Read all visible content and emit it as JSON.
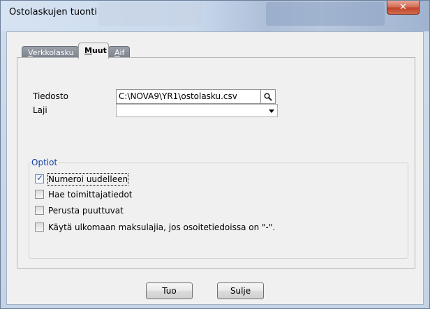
{
  "window": {
    "title": "Ostolaskujen tuonti",
    "close_glyph": "✕"
  },
  "tabs": [
    {
      "key": "V",
      "rest": "erkkolasku",
      "active": false
    },
    {
      "key": "M",
      "rest": "uut",
      "active": true
    },
    {
      "key": "A",
      "rest": "if",
      "active": false
    }
  ],
  "form": {
    "file_label": "Tiedosto",
    "file_value": "C:\\NOVA9\\YR1\\ostolasku.csv",
    "browse_icon": "search-icon",
    "type_label": "Laji",
    "type_value": ""
  },
  "options": {
    "group_label": "Optiot",
    "items": [
      {
        "label": "Numeroi uudelleen",
        "checked": true
      },
      {
        "label": "Hae toimittajatiedot",
        "checked": false
      },
      {
        "label": "Perusta puuttuvat",
        "checked": false
      },
      {
        "label": "Käytä ulkomaan maksulajia, jos osoitetiedoissa on \"-\".",
        "checked": false
      }
    ]
  },
  "buttons": {
    "import_label": "Tuo",
    "close_label": "Sulje"
  }
}
